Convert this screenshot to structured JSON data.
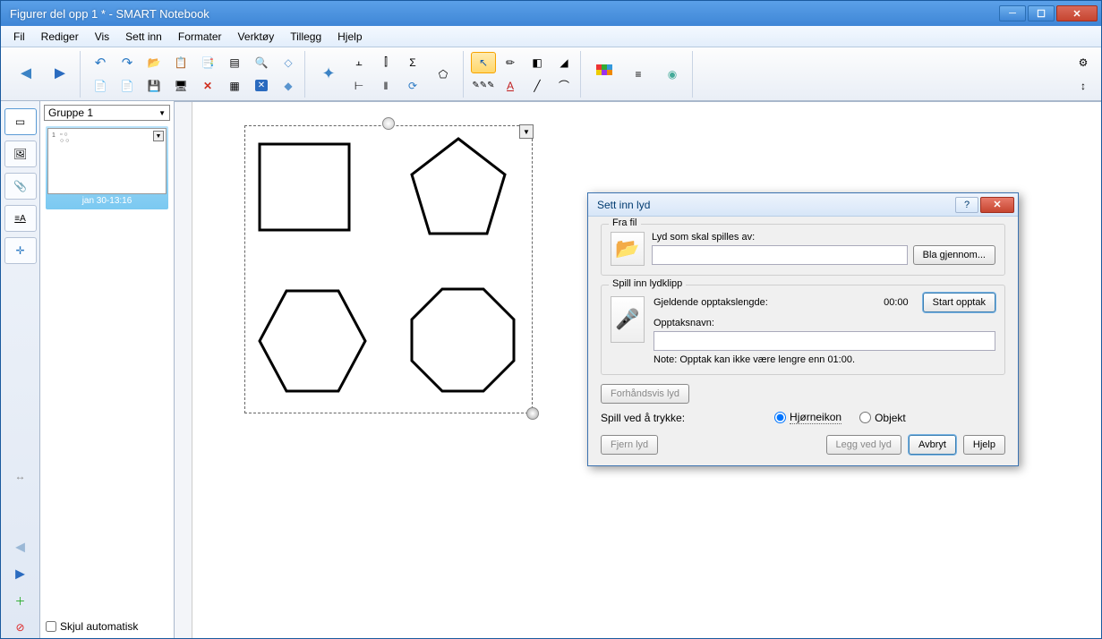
{
  "window": {
    "title": "Figurer del opp 1 * - SMART Notebook"
  },
  "menu": {
    "fil": "Fil",
    "rediger": "Rediger",
    "vis": "Vis",
    "settinn": "Sett inn",
    "formater": "Formater",
    "verktoy": "Verktøy",
    "tillegg": "Tillegg",
    "hjelp": "Hjelp"
  },
  "panel": {
    "group": "Gruppe 1",
    "thumb_idx": "1",
    "thumb_label": "jan 30-13:16",
    "hide_auto": "Skjul automatisk"
  },
  "dialog": {
    "title": "Sett inn lyd",
    "fra_fil": "Fra fil",
    "lyd_spilles": "Lyd som skal spilles av:",
    "bla": "Bla gjennom...",
    "spill_inn": "Spill inn lydklipp",
    "gjeldende": "Gjeldende opptakslengde:",
    "time": "00:00",
    "start": "Start opptak",
    "opptak_navn": "Opptaksnavn:",
    "note": "Note: Opptak kan ikke være lengre enn 01:00.",
    "forhandsvis": "Forhåndsvis lyd",
    "spillved": "Spill ved å trykke:",
    "hjorne": "Hjørneikon",
    "objekt": "Objekt",
    "fjern": "Fjern lyd",
    "leggved": "Legg ved lyd",
    "avbryt": "Avbryt",
    "hjelp": "Hjelp"
  }
}
